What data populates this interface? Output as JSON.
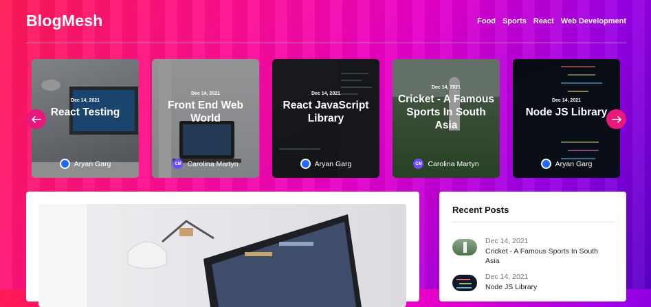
{
  "header": {
    "logo": "BlogMesh",
    "nav": [
      "Food",
      "Sports",
      "React",
      "Web Development"
    ]
  },
  "slider": {
    "prev_icon": "arrow-left-icon",
    "next_icon": "arrow-right-icon",
    "cards": [
      {
        "date": "Dec 14, 2021",
        "title": "React Testing",
        "author": "Aryan Garg",
        "avatar": "blue-circle"
      },
      {
        "date": "Dec 14, 2021",
        "title": "Front End Web World",
        "author": "Carolina Martyn",
        "avatar": "CM"
      },
      {
        "date": "Dec 14, 2021",
        "title": "React JavaScript Library",
        "author": "Aryan Garg",
        "avatar": "blue-circle"
      },
      {
        "date": "Dec 14, 2021",
        "title": "Cricket - A Famous Sports In South Asia",
        "author": "Carolina Martyn",
        "avatar": "CM"
      },
      {
        "date": "Dec 14, 2021",
        "title": "Node JS Library",
        "author": "Aryan Garg",
        "avatar": "blue-circle"
      }
    ]
  },
  "recent": {
    "heading": "Recent Posts",
    "posts": [
      {
        "date": "Dec 14, 2021",
        "title": "Cricket - A Famous Sports In South Asia"
      },
      {
        "date": "Dec 14, 2021",
        "title": "Node JS Library"
      }
    ]
  },
  "colors": {
    "accent": "#e8197d",
    "avatar_blue": "#1e6cff"
  }
}
